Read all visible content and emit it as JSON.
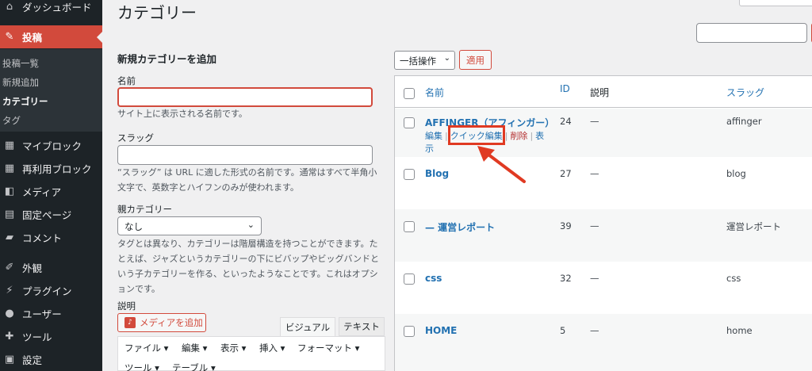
{
  "sidebar": {
    "items": [
      {
        "label": "ダッシュボード",
        "icon": "dashboard-icon",
        "glyph": "⌂"
      },
      {
        "label": "投稿",
        "icon": "pin-icon",
        "glyph": "✎"
      },
      {
        "label": "マイブロック",
        "icon": "grid-icon",
        "glyph": "▦"
      },
      {
        "label": "再利用ブロック",
        "icon": "grid-icon",
        "glyph": "▦"
      },
      {
        "label": "メディア",
        "icon": "media-icon",
        "glyph": "◧"
      },
      {
        "label": "固定ページ",
        "icon": "page-icon",
        "glyph": "▤"
      },
      {
        "label": "コメント",
        "icon": "comment-icon",
        "glyph": "▰"
      },
      {
        "label": "外観",
        "icon": "appearance-icon",
        "glyph": "✐"
      },
      {
        "label": "プラグイン",
        "icon": "plugin-icon",
        "glyph": "⚡"
      },
      {
        "label": "ユーザー",
        "icon": "user-icon",
        "glyph": "●"
      },
      {
        "label": "ツール",
        "icon": "wrench-icon",
        "glyph": "✚"
      },
      {
        "label": "設定",
        "icon": "settings-icon",
        "glyph": "▣"
      }
    ],
    "submenu": [
      "投稿一覧",
      "新規追加",
      "カテゴリー",
      "タグ"
    ]
  },
  "page": {
    "title": "カテゴリー"
  },
  "form": {
    "heading": "新規カテゴリーを追加",
    "name_label": "名前",
    "name_help": "サイト上に表示される名前です。",
    "slug_label": "スラッグ",
    "slug_help": "“スラッグ” は URL に適した形式の名前です。通常はすべて半角小文字で、英数字とハイフンのみが使われます。",
    "parent_label": "親カテゴリー",
    "parent_value": "なし",
    "parent_help": "タグとは異なり、カテゴリーは階層構造を持つことができます。たとえば、ジャズというカテゴリーの下にビバップやビッグバンドという子カテゴリーを作る、といったようなことです。これはオプションです。",
    "desc_label": "説明",
    "media_button": "メディアを追加",
    "tab_visual": "ビジュアル",
    "tab_text": "テキスト",
    "toolbar_row1": [
      "ファイル ▾",
      "編集 ▾",
      "表示 ▾",
      "挿入 ▾",
      "フォーマット ▾"
    ],
    "toolbar_row2": [
      "ツール ▾",
      "テーブル ▾"
    ]
  },
  "bulk": {
    "label": "一括操作",
    "apply": "適用"
  },
  "table": {
    "headers": {
      "name": "名前",
      "id": "ID",
      "description": "説明",
      "slug": "スラッグ"
    },
    "rows": [
      {
        "name": "AFFINGER（アフィンガー）",
        "id": "24",
        "description": "—",
        "slug": "affinger"
      },
      {
        "name": "Blog",
        "id": "27",
        "description": "—",
        "slug": "blog"
      },
      {
        "name": "— 運営レポート",
        "id": "39",
        "description": "—",
        "slug": "運営レポート"
      },
      {
        "name": "css",
        "id": "32",
        "description": "—",
        "slug": "css"
      },
      {
        "name": "HOME",
        "id": "5",
        "description": "—",
        "slug": "home"
      }
    ],
    "row_actions": {
      "edit": "編集",
      "quick_edit": "クイック編集",
      "delete": "削除",
      "view_line1": "表",
      "view_line2": "示"
    }
  },
  "colors": {
    "accent": "#d24a3c",
    "link": "#2271b1",
    "sidebar_bg": "#1d2327",
    "annotation": "#e03a22"
  }
}
